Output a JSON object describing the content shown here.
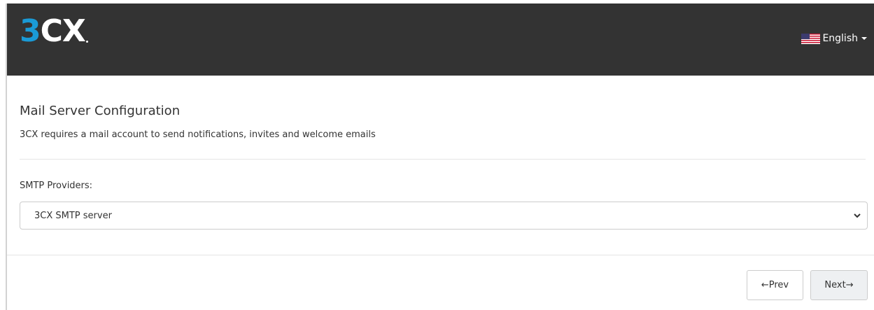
{
  "header": {
    "logo_three": "3",
    "logo_cx": "CX",
    "language": "English",
    "flag_icon": "us-flag-icon"
  },
  "page": {
    "title": "Mail Server Configuration",
    "subtitle": "3CX requires a mail account to send notifications, invites and welcome emails"
  },
  "smtp": {
    "label": "SMTP Providers:",
    "selected": "3CX SMTP server"
  },
  "footer": {
    "prev_label": "←Prev",
    "next_label": "Next→"
  },
  "colors": {
    "header_bg": "#333333",
    "logo_accent": "#1a9ad6",
    "next_button_bg": "#eef0f2"
  }
}
